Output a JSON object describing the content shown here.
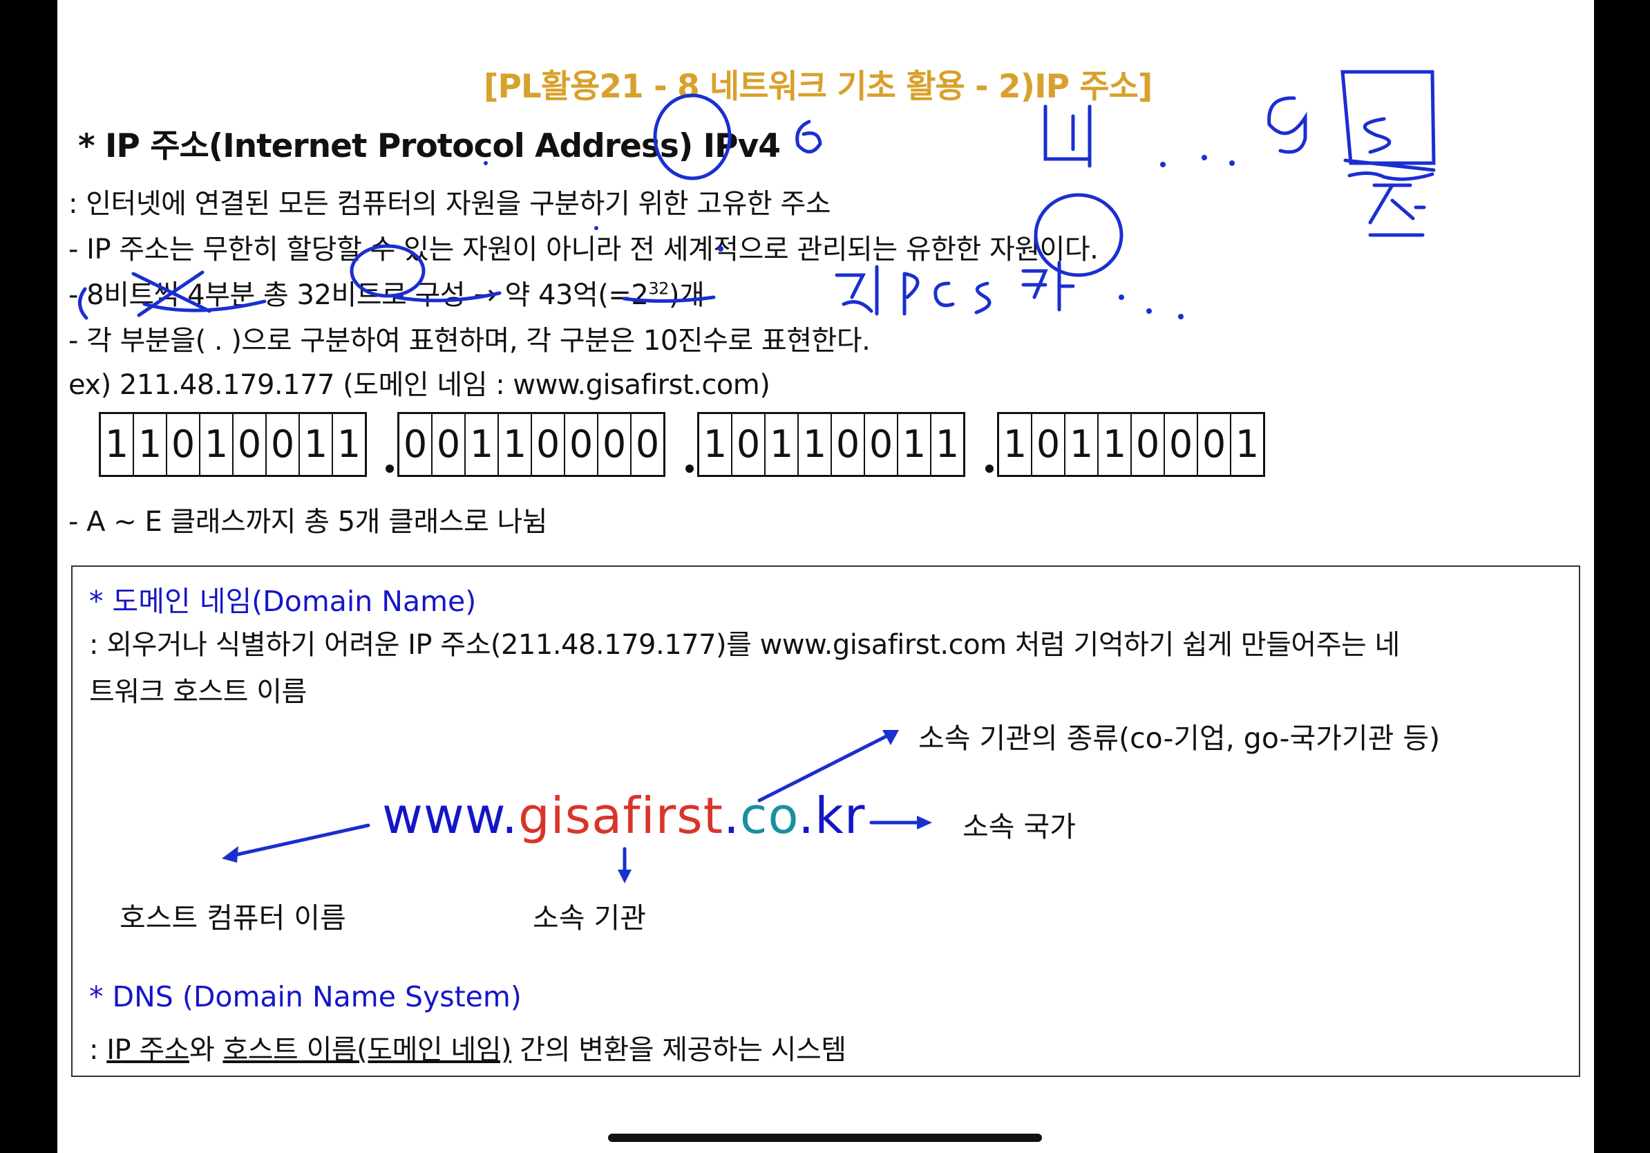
{
  "title": "[PL활용21 - 8 네트워크 기초 활용 - 2)IP 주소]",
  "heading": "* IP 주소(Internet Protocol Address) IPv4",
  "lines": {
    "l1": ": 인터넷에 연결된 모든 컴퓨터의 자원을 구분하기 위한 고유한 주소",
    "l2": "- IP 주소는 무한히 할당할 수 있는 자원이 아니라 전 세계적으로 관리되는 유한한 자원이다.",
    "l3a": "- 8비트씩 4부분 총 32비트로 구성 → 약 43억(=2",
    "l3sup": "32",
    "l3b": ")개",
    "l4": "- 각 부분을( . )으로 구분하여 표현하며, 각 구분은 10진수로 표현한다.",
    "l5": "ex) 211.48.179.177 (도메인 네임 : www.gisafirst.com)",
    "l6": "- A ~ E 클래스까지 총 5개 클래스로 나뉨"
  },
  "octets": [
    [
      "1",
      "1",
      "0",
      "1",
      "0",
      "0",
      "1",
      "1"
    ],
    [
      "0",
      "0",
      "1",
      "1",
      "0",
      "0",
      "0",
      "0"
    ],
    [
      "1",
      "0",
      "1",
      "1",
      "0",
      "0",
      "1",
      "1"
    ],
    [
      "1",
      "0",
      "1",
      "1",
      "0",
      "0",
      "0",
      "1"
    ]
  ],
  "domain_box": {
    "heading": "* 도메인 네임(Domain Name)",
    "desc1": ": 외우거나 식별하기 어려운 IP 주소(211.48.179.177)를 www.gisafirst.com 처럼 기억하기 쉽게 만들어주는 네",
    "desc2": "트워크 호스트 이름",
    "domain": {
      "www": "www.",
      "gisafirst": "gisafirst",
      "dot1": ".",
      "co": "co",
      "dot2": ".",
      "kr": "kr"
    },
    "colors": {
      "www": "#1515c8",
      "gisafirst": "#d8352a",
      "co": "#1a8fa0",
      "kr": "#1515c8",
      "arrow": "#1a2fd0"
    },
    "label_org_type": "소속 기관의 종류(co-기업, go-국가기관 등)",
    "label_country": "소속 국가",
    "label_host": "호스트 컴퓨터 이름",
    "label_org": "소속 기관",
    "dns_heading": "* DNS (Domain Name System)",
    "dns_prefix": ": ",
    "dns_ip": "IP 주소",
    "dns_mid": "와 ",
    "dns_host": "호스트 이름(도메인 네임)",
    "dns_rest": " 간의 변환을 제공하는 시스템"
  },
  "handwriting": {
    "six": "6",
    "ne": "네",
    "g": "g",
    "s_box": "S",
    "jeon": "전",
    "geol": "걸",
    "pcs": "pcs",
    "ki": "키"
  },
  "ink_color": "#1a2fd0"
}
